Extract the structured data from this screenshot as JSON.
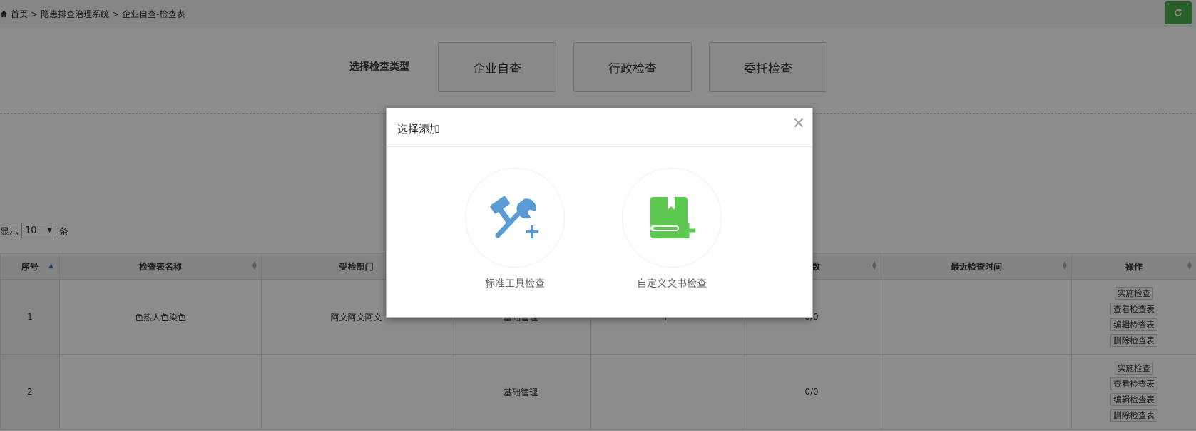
{
  "breadcrumb": {
    "home": "首页",
    "sep1": ">",
    "system": "隐患排查治理系统",
    "sep2": ">",
    "current": "企业自查-检查表"
  },
  "check_type": {
    "label": "选择检查类型",
    "buttons": [
      "企业自查",
      "行政检查",
      "委托检查"
    ]
  },
  "length_menu": {
    "prefix": "显示",
    "value": "10",
    "suffix": "条"
  },
  "table": {
    "columns": [
      "序号",
      "检查表名称",
      "受检部门",
      "",
      "",
      "次数",
      "最近检查时间",
      "操作"
    ],
    "rows": [
      {
        "index": "1",
        "name": "色热人色染色",
        "dept": "阿文阿文阿文",
        "category": "基础管理",
        "col5": "/",
        "count": "0/0",
        "last_time": ""
      },
      {
        "index": "2",
        "name": "",
        "dept": "",
        "category": "基础管理",
        "col5": "",
        "count": "0/0",
        "last_time": ""
      }
    ],
    "actions": [
      "实施检查",
      "查看检查表",
      "编辑检查表",
      "删除检查表"
    ]
  },
  "modal": {
    "title": "选择添加",
    "close": "×",
    "options": [
      {
        "label": "标准工具检查",
        "icon": "tools-add-icon"
      },
      {
        "label": "自定义文书检查",
        "icon": "document-add-icon"
      }
    ]
  },
  "colors": {
    "accent_blue": "#5b9bd5",
    "accent_green": "#5cc84f",
    "refresh_green": "#4cae4c"
  }
}
